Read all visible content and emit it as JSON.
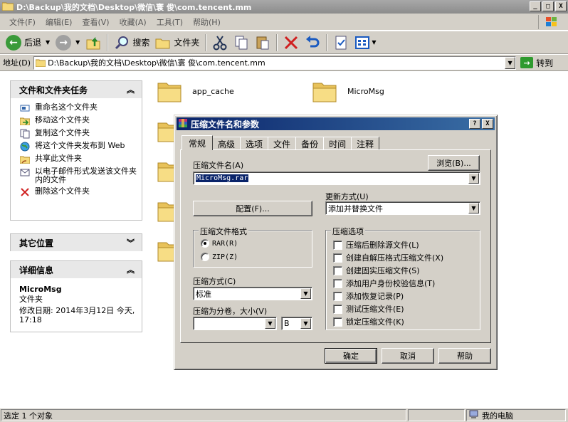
{
  "window": {
    "title": "D:\\Backup\\我的文档\\Desktop\\微信\\寰   俊\\com.tencent.mm",
    "min_label": "_",
    "max_label": "□",
    "close_label": "X"
  },
  "menu": [
    "文件(F)",
    "编辑(E)",
    "查看(V)",
    "收藏(A)",
    "工具(T)",
    "帮助(H)"
  ],
  "toolbar": {
    "back_label": "后退",
    "search_label": "搜索",
    "folders_label": "文件夹"
  },
  "address": {
    "label": "地址(D)",
    "path": "D:\\Backup\\我的文档\\Desktop\\微信\\寰   俊\\com.tencent.mm",
    "go_label": "转到"
  },
  "tasks_pane": {
    "title": "文件和文件夹任务",
    "items": [
      {
        "label": "重命名这个文件夹",
        "icon": "rename-icon"
      },
      {
        "label": "移动这个文件夹",
        "icon": "move-icon"
      },
      {
        "label": "复制这个文件夹",
        "icon": "copy-icon"
      },
      {
        "label": "将这个文件夹发布到 Web",
        "icon": "publish-web-icon"
      },
      {
        "label": "共享此文件夹",
        "icon": "share-icon"
      },
      {
        "label": "以电子邮件形式发送该文件夹内的文件",
        "icon": "email-icon"
      },
      {
        "label": "删除这个文件夹",
        "icon": "delete-icon"
      }
    ]
  },
  "places_pane": {
    "title": "其它位置"
  },
  "details_pane": {
    "title": "详细信息",
    "name": "MicroMsg",
    "type": "文件夹",
    "modified": "修改日期: 2014年3月12日 今天, 17:18"
  },
  "folders": [
    {
      "name": "app_cache"
    },
    {
      "name": "MicroMsg"
    }
  ],
  "status": {
    "left": "选定 1 个对象",
    "right": "我的电脑"
  },
  "dialog": {
    "title": "压缩文件名和参数",
    "help_btn": "?",
    "close_btn": "X",
    "tabs": [
      "常规",
      "高级",
      "选项",
      "文件",
      "备份",
      "时间",
      "注释"
    ],
    "archive_name_label": "压缩文件名(A)",
    "archive_name_value": "MicroMsg.rar",
    "browse_label": "浏览(B)...",
    "update_mode_label": "更新方式(U)",
    "update_mode_value": "添加并替换文件",
    "profiles_label": "配置(F)...",
    "format_group": "压缩文件格式",
    "format_rar": "RAR(R)",
    "format_zip": "ZIP(Z)",
    "format_selected": "RAR",
    "method_label": "压缩方式(C)",
    "method_value": "标准",
    "split_label": "压缩为分卷，大小(V)",
    "split_value": "",
    "split_unit": "B",
    "options_group": "压缩选项",
    "options": [
      "压缩后删除源文件(L)",
      "创建自解压格式压缩文件(X)",
      "创建固实压缩文件(S)",
      "添加用户身份校验信息(T)",
      "添加恢复记录(P)",
      "测试压缩文件(E)",
      "锁定压缩文件(K)"
    ],
    "ok_label": "确定",
    "cancel_label": "取消",
    "help_label": "帮助"
  },
  "colors": {
    "dialog_title": "#0a246a",
    "face": "#d4d0c8",
    "selection": "#0a246a",
    "folder": "#f5d97a"
  }
}
